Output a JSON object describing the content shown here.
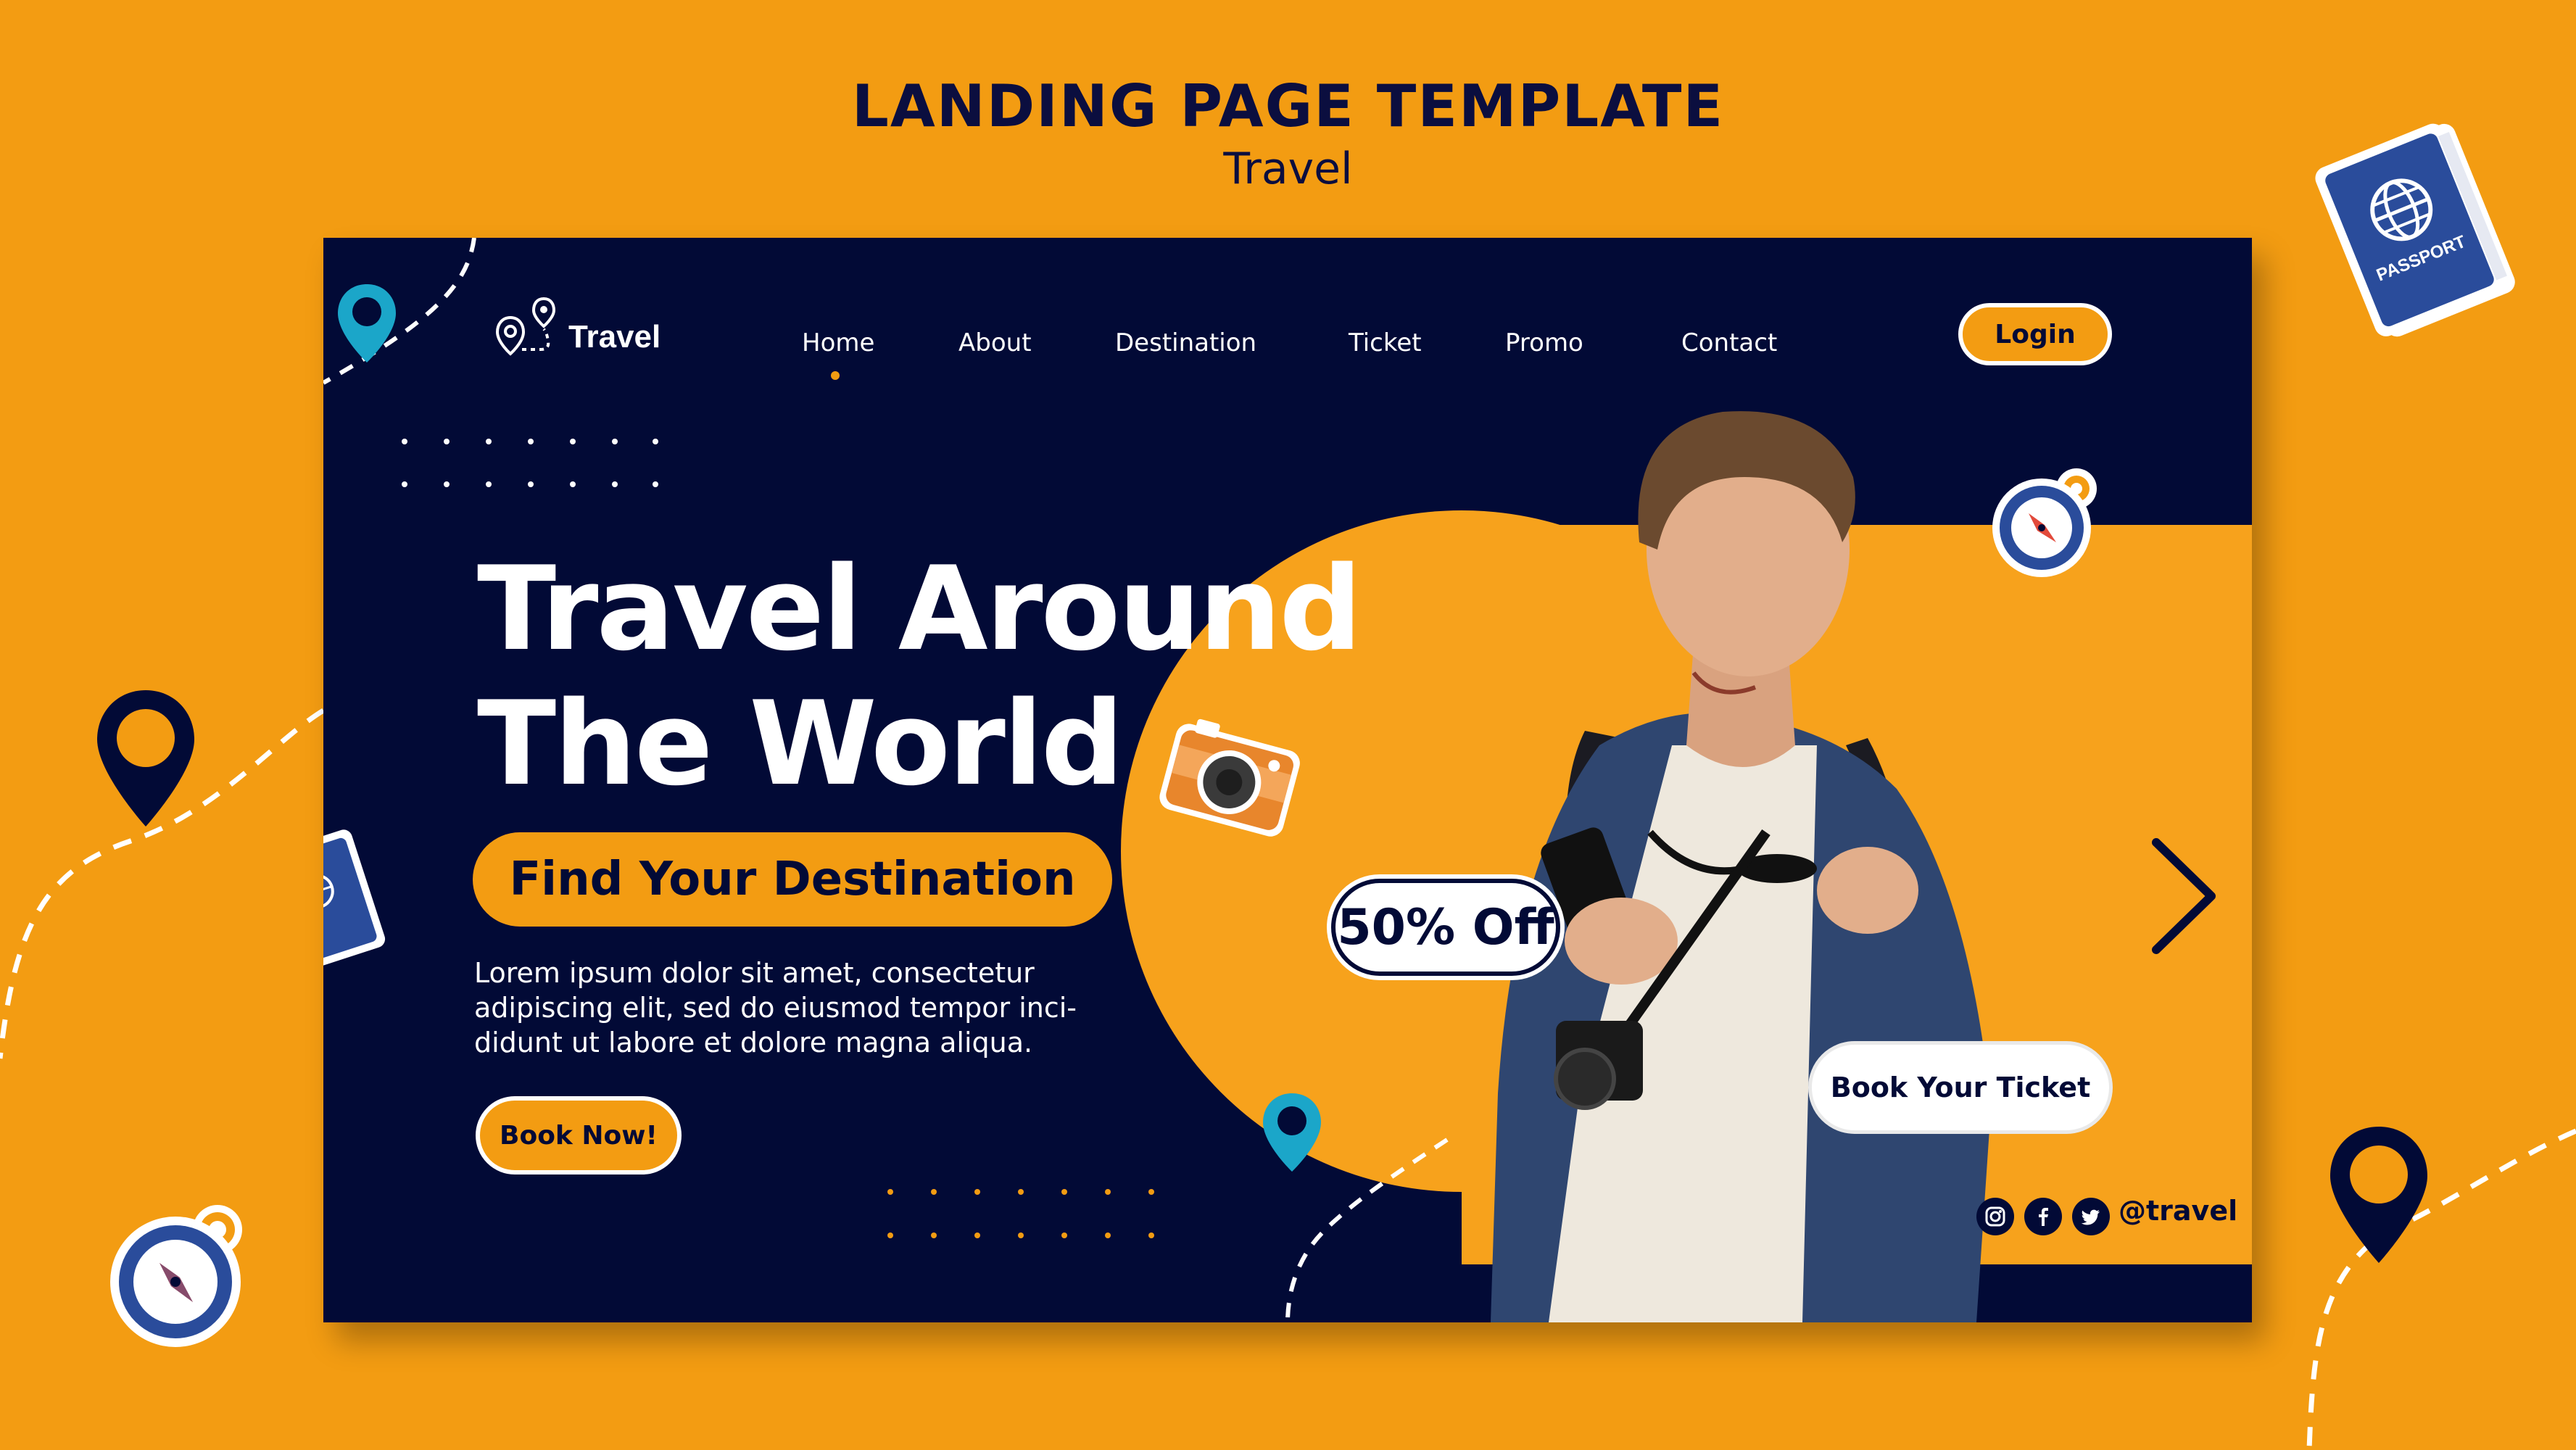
{
  "header": {
    "title": "LANDING PAGE TEMPLATE",
    "subtitle": "Travel"
  },
  "colors": {
    "background": "#F39C12",
    "card": "#020A36",
    "accent": "#F39C12",
    "pin_teal": "#1BA6C9",
    "white": "#FFFFFF"
  },
  "nav": {
    "brand": "Travel",
    "brand_icon": "map-route-icon",
    "items": [
      {
        "label": "Home",
        "active": true
      },
      {
        "label": "About"
      },
      {
        "label": "Destination"
      },
      {
        "label": "Ticket"
      },
      {
        "label": "Promo"
      },
      {
        "label": "Contact"
      }
    ],
    "login_label": "Login"
  },
  "hero": {
    "title_line1": "Travel Around",
    "title_line2": "The World",
    "tagline": "Find Your Destination",
    "description_lines": [
      "Lorem ipsum dolor sit amet, consectetur",
      "adipiscing elit, sed do eiusmod tempor inci-",
      "didunt ut labore et dolore magna aliqua."
    ],
    "cta_label": "Book Now!"
  },
  "promo": {
    "offer": "50% Off",
    "book_ticket_label": "Book Your Ticket",
    "next_icon": "chevron-right-icon"
  },
  "social": {
    "icons": [
      "instagram-icon",
      "facebook-icon",
      "twitter-icon"
    ],
    "handle": "@travel"
  },
  "decor": {
    "passport_label": "PASSPORT",
    "icons": [
      "location-pin-icon",
      "passport-icon",
      "compass-icon",
      "camera-icon"
    ]
  }
}
